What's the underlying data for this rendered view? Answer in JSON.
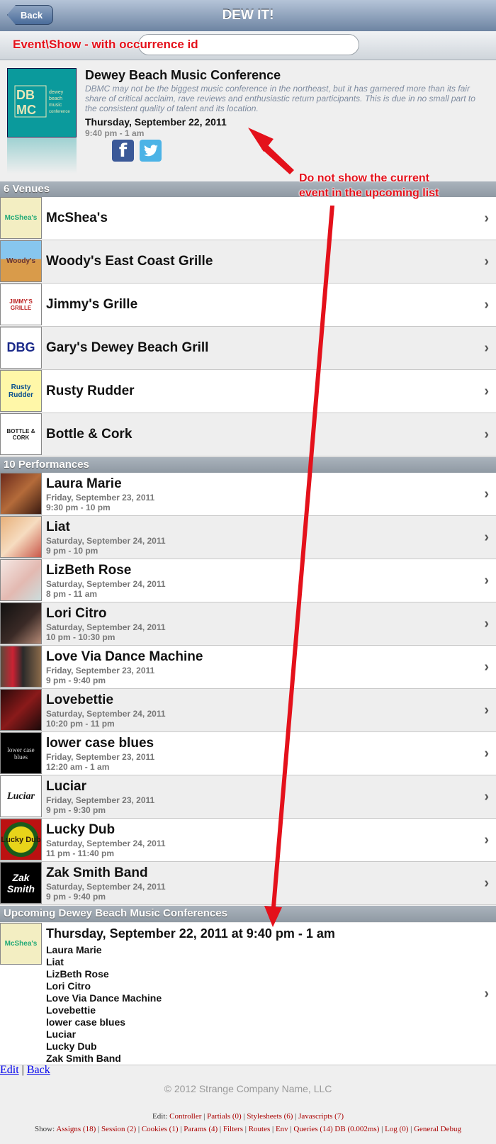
{
  "nav": {
    "back_label": "Back",
    "title": "DEW IT!"
  },
  "search": {
    "caption": "Event\\Show - with occurrence id"
  },
  "event": {
    "logo_text": "DBMC",
    "logo_sub": "dewey beach music conference 2011",
    "title": "Dewey Beach Music Conference",
    "description": "DBMC may not be the biggest music conference in the northeast, but it has garnered more than its fair share of critical acclaim, rave reviews and enthusiastic return participants. This is due in no small part to the consistent quality of talent and its location.",
    "date": "Thursday, September 22, 2011",
    "time": "9:40 pm - 1 am",
    "facebook_icon": "f",
    "twitter_icon": "t"
  },
  "venues": {
    "header": "6 Venues",
    "items": [
      {
        "name": "McShea's",
        "thumb": "McShea's"
      },
      {
        "name": "Woody's East Coast Grille",
        "thumb": "Woody's"
      },
      {
        "name": "Jimmy's Grille",
        "thumb": "JIMMY'S GRILLE"
      },
      {
        "name": "Gary's Dewey Beach Grill",
        "thumb": "DBG"
      },
      {
        "name": "Rusty Rudder",
        "thumb": "Rusty Rudder"
      },
      {
        "name": "Bottle & Cork",
        "thumb": "BOTTLE & CORK"
      }
    ]
  },
  "performances": {
    "header": "10 Performances",
    "items": [
      {
        "name": "Laura Marie",
        "date": "Friday, September 23, 2011",
        "time": "9:30 pm - 10 pm"
      },
      {
        "name": "Liat",
        "date": "Saturday, September 24, 2011",
        "time": "9 pm - 10 pm"
      },
      {
        "name": "LizBeth Rose",
        "date": "Saturday, September 24, 2011",
        "time": "8 pm - 11 am"
      },
      {
        "name": "Lori Citro",
        "date": "Saturday, September 24, 2011",
        "time": "10 pm - 10:30 pm"
      },
      {
        "name": "Love Via Dance Machine",
        "date": "Friday, September 23, 2011",
        "time": "9 pm - 9:40 pm"
      },
      {
        "name": "Lovebettie",
        "date": "Saturday, September 24, 2011",
        "time": "10:20 pm - 11 pm"
      },
      {
        "name": "lower case blues",
        "date": "Friday, September 23, 2011",
        "time": "12:20 am - 1 am",
        "thumb": "lower case blues"
      },
      {
        "name": "Luciar",
        "date": "Friday, September 23, 2011",
        "time": "9 pm - 9:30 pm",
        "thumb": "Luciar"
      },
      {
        "name": "Lucky Dub",
        "date": "Saturday, September 24, 2011",
        "time": "11 pm - 11:40 pm",
        "thumb": "Lucky Dub"
      },
      {
        "name": "Zak Smith Band",
        "date": "Saturday, September 24, 2011",
        "time": "9 pm - 9:40 pm",
        "thumb": "Zak Smith"
      }
    ]
  },
  "upcoming": {
    "header": "Upcoming Dewey Beach Music Conferences",
    "heading": "Thursday, September 22, 2011 at 9:40 pm - 1 am",
    "performers": [
      "Laura Marie",
      "Liat",
      "LizBeth Rose",
      "Lori Citro",
      "Love Via Dance Machine",
      "Lovebettie",
      "lower case blues",
      "Luciar",
      "Lucky Dub",
      "Zak Smith Band"
    ]
  },
  "footer": {
    "edit_link": "Edit",
    "separator": " | ",
    "back_link": "Back",
    "copyright": "© 2012 Strange Company Name, LLC",
    "debug_edit_prefix": "Edit:",
    "debug_edit_links": [
      "Controller",
      "Partials (0)",
      "Stylesheets (6)",
      "Javascripts (7)"
    ],
    "debug_show_prefix": "Show:",
    "debug_show_links": [
      "Assigns (18)",
      "Session (2)",
      "Cookies (1)",
      "Params (4)",
      "Filters",
      "Routes",
      "Env",
      "Queries (14) DB (0.002ms)",
      "Log (0)",
      "General Debug"
    ]
  },
  "annotation": {
    "line1": "Do not show the current",
    "line2": "event in the upcoming list"
  },
  "colors": {
    "annotation": "#e4111b",
    "nav": "#6d84a2",
    "section": "#9aa3ad"
  }
}
